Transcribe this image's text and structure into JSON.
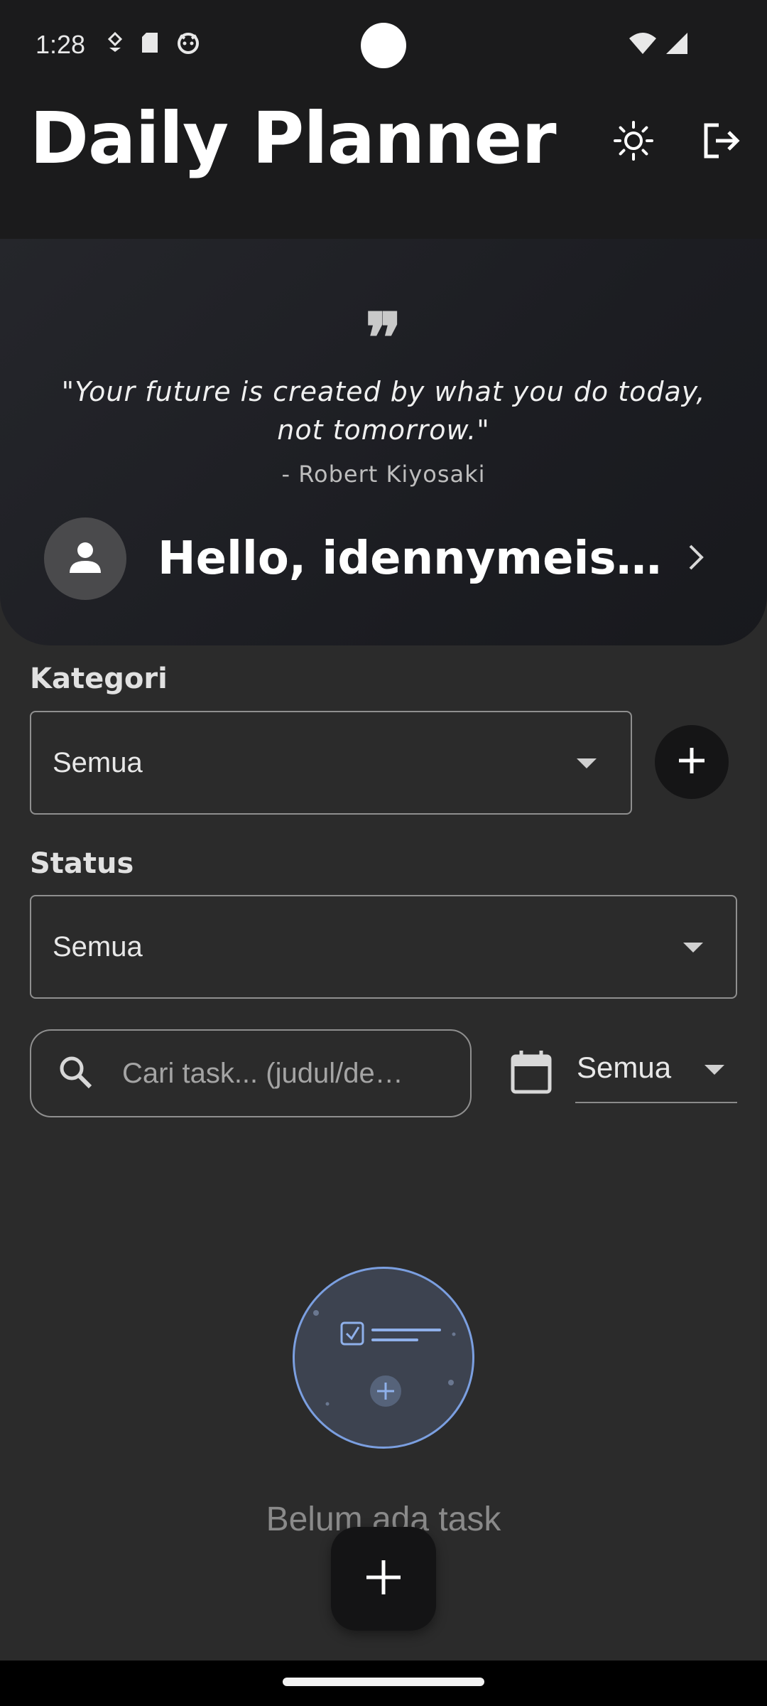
{
  "status_bar": {
    "time": "1:28",
    "left_icons": [
      "location-pin-icon",
      "sd-card-icon",
      "cat-face-icon"
    ],
    "right_icons": [
      "wifi-icon",
      "signal-icon"
    ]
  },
  "header": {
    "title": "Daily Planner",
    "theme_toggle_icon": "sun-icon",
    "logout_icon": "logout-icon"
  },
  "hero": {
    "quote": "\"Your future is created by what you do today, not tomorrow.\"",
    "author": "- Robert Kiyosaki",
    "greeting": "Hello, idennymeister…"
  },
  "filters": {
    "category_label": "Kategori",
    "category_value": "Semua",
    "status_label": "Status",
    "status_value": "Semua",
    "search_placeholder": "Cari task... (judul/de…",
    "date_value": "Semua"
  },
  "empty_state": {
    "message": "Belum ada task"
  },
  "colors": {
    "background": "#2b2b2b",
    "header": "#1b1b1c",
    "accent_ring": "#7b9fe0"
  }
}
